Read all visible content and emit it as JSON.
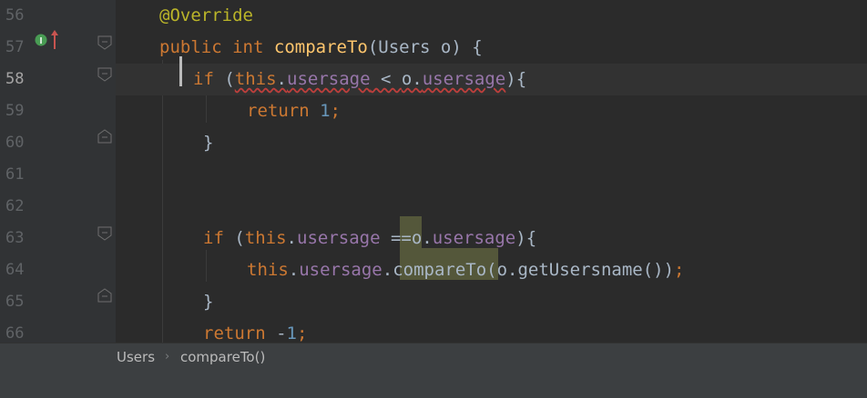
{
  "editor": {
    "lines": [
      {
        "num": "56",
        "tokens": [
          {
            "t": "@Override",
            "c": "ann"
          }
        ]
      },
      {
        "num": "57",
        "tokens": [
          {
            "t": "public",
            "c": "kw"
          },
          {
            "t": " ",
            "c": "plain"
          },
          {
            "t": "int",
            "c": "kw"
          },
          {
            "t": " ",
            "c": "plain"
          },
          {
            "t": "compareTo",
            "c": "fn"
          },
          {
            "t": "(Users o) {",
            "c": "plain"
          }
        ]
      },
      {
        "num": "58",
        "tokens": [
          {
            "t": "if",
            "c": "kw"
          },
          {
            "t": " (",
            "c": "plain"
          },
          {
            "t": "this",
            "c": "kw wavy"
          },
          {
            "t": ".",
            "c": "plain wavy"
          },
          {
            "t": "usersage",
            "c": "fld wavy"
          },
          {
            "t": " < ",
            "c": "plain wavy"
          },
          {
            "t": "o.",
            "c": "plain wavy"
          },
          {
            "t": "usersage",
            "c": "fld wavy"
          },
          {
            "t": "){",
            "c": "plain"
          }
        ]
      },
      {
        "num": "59",
        "tokens": [
          {
            "t": "return",
            "c": "kw"
          },
          {
            "t": " ",
            "c": "plain"
          },
          {
            "t": "1",
            "c": "num"
          },
          {
            "t": ";",
            "c": "kw"
          }
        ]
      },
      {
        "num": "60",
        "tokens": [
          {
            "t": "}",
            "c": "plain"
          }
        ]
      },
      {
        "num": "61",
        "tokens": []
      },
      {
        "num": "62",
        "tokens": []
      },
      {
        "num": "63",
        "tokens": [
          {
            "t": "if",
            "c": "kw"
          },
          {
            "t": " (",
            "c": "plain"
          },
          {
            "t": "this",
            "c": "kw"
          },
          {
            "t": ".",
            "c": "plain"
          },
          {
            "t": "usersage",
            "c": "fld"
          },
          {
            "t": " ==",
            "c": "plain"
          },
          {
            "t": "o.",
            "c": "plain"
          },
          {
            "t": "usersage",
            "c": "fld"
          },
          {
            "t": "){",
            "c": "plain"
          }
        ]
      },
      {
        "num": "64",
        "tokens": [
          {
            "t": "this",
            "c": "kw"
          },
          {
            "t": ".",
            "c": "plain"
          },
          {
            "t": "usersage",
            "c": "fld"
          },
          {
            "t": ".",
            "c": "plain"
          },
          {
            "t": "compareTo",
            "c": "plain"
          },
          {
            "t": "(o.getUsersname())",
            "c": "plain"
          },
          {
            "t": ";",
            "c": "kw"
          }
        ]
      },
      {
        "num": "65",
        "tokens": [
          {
            "t": "}",
            "c": "plain"
          }
        ]
      },
      {
        "num": "66",
        "tokens": [
          {
            "t": "return",
            "c": "kw"
          },
          {
            "t": " -",
            "c": "plain"
          },
          {
            "t": "1",
            "c": "num"
          },
          {
            "t": ";",
            "c": "kw"
          }
        ]
      }
    ]
  },
  "breadcrumb": {
    "items": [
      "Users",
      "compareTo()"
    ],
    "separator": "›"
  },
  "gutter_icons": {
    "implements": "implements-method-icon",
    "implements_letter": "I"
  },
  "colors": {
    "background": "#2b2b2b",
    "gutter": "#313335",
    "keyword": "#cc7832",
    "annotation": "#bbb529",
    "method": "#ffc66d",
    "field": "#9876aa",
    "number": "#6897bb",
    "text": "#a9b7c6",
    "highlight": "#54573a"
  }
}
